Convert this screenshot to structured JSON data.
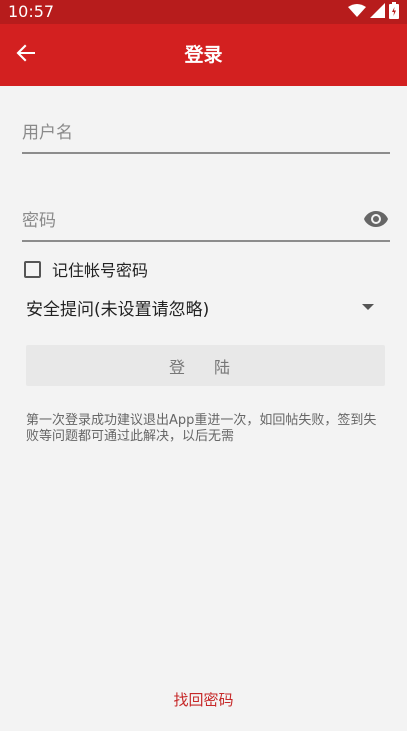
{
  "status_bar": {
    "time": "10:57",
    "icons": [
      "wifi-icon",
      "signal-icon",
      "battery-icon"
    ]
  },
  "app_bar": {
    "back_icon": "arrow-left-icon",
    "title": "登录"
  },
  "form": {
    "username": {
      "placeholder": "用户名",
      "value": ""
    },
    "password": {
      "placeholder": "密码",
      "value": "",
      "toggle_icon": "eye-icon"
    },
    "remember": {
      "label": "记住帐号密码",
      "checked": false
    },
    "security_question": {
      "selected": "安全提问(未设置请忽略)"
    },
    "login_button": {
      "label": "登 陆"
    }
  },
  "tip": "第一次登录成功建议退出App重进一次，如回帖失败，签到失败等问题都可通过此解决，以后无需",
  "footer": {
    "recover_link": "找回密码"
  },
  "colors": {
    "status_bar": "#b71c1c",
    "app_bar": "#d32020",
    "background": "#f3f3f3",
    "link": "#c62828"
  }
}
